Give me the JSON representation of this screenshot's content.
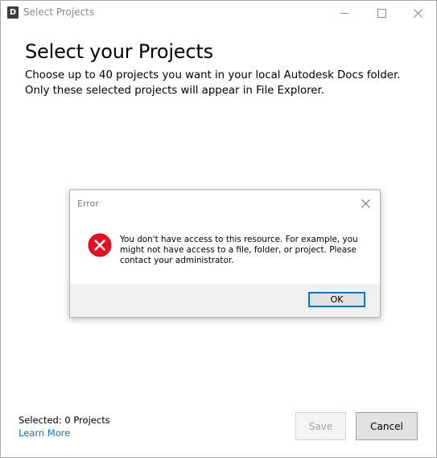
{
  "window": {
    "title": "Select Projects",
    "app_icon_letter": "D"
  },
  "main": {
    "heading": "Select your Projects",
    "description_line1": "Choose up to 40 projects you want in your local Autodesk Docs folder.",
    "description_line2": "Only these selected projects will appear in File Explorer."
  },
  "dialog": {
    "title": "Error",
    "message": "You don't have access to this resource. For example, you might not have access to a file, folder, or project.  Please contact your administrator.",
    "ok_label": "OK",
    "icon": "error-icon",
    "icon_color": "#e81123"
  },
  "footer": {
    "selected_text": "Selected: 0 Projects",
    "learn_more": "Learn More",
    "save_label": "Save",
    "cancel_label": "Cancel"
  },
  "colors": {
    "link": "#1a6fbf",
    "focus_border": "#0078d7"
  }
}
